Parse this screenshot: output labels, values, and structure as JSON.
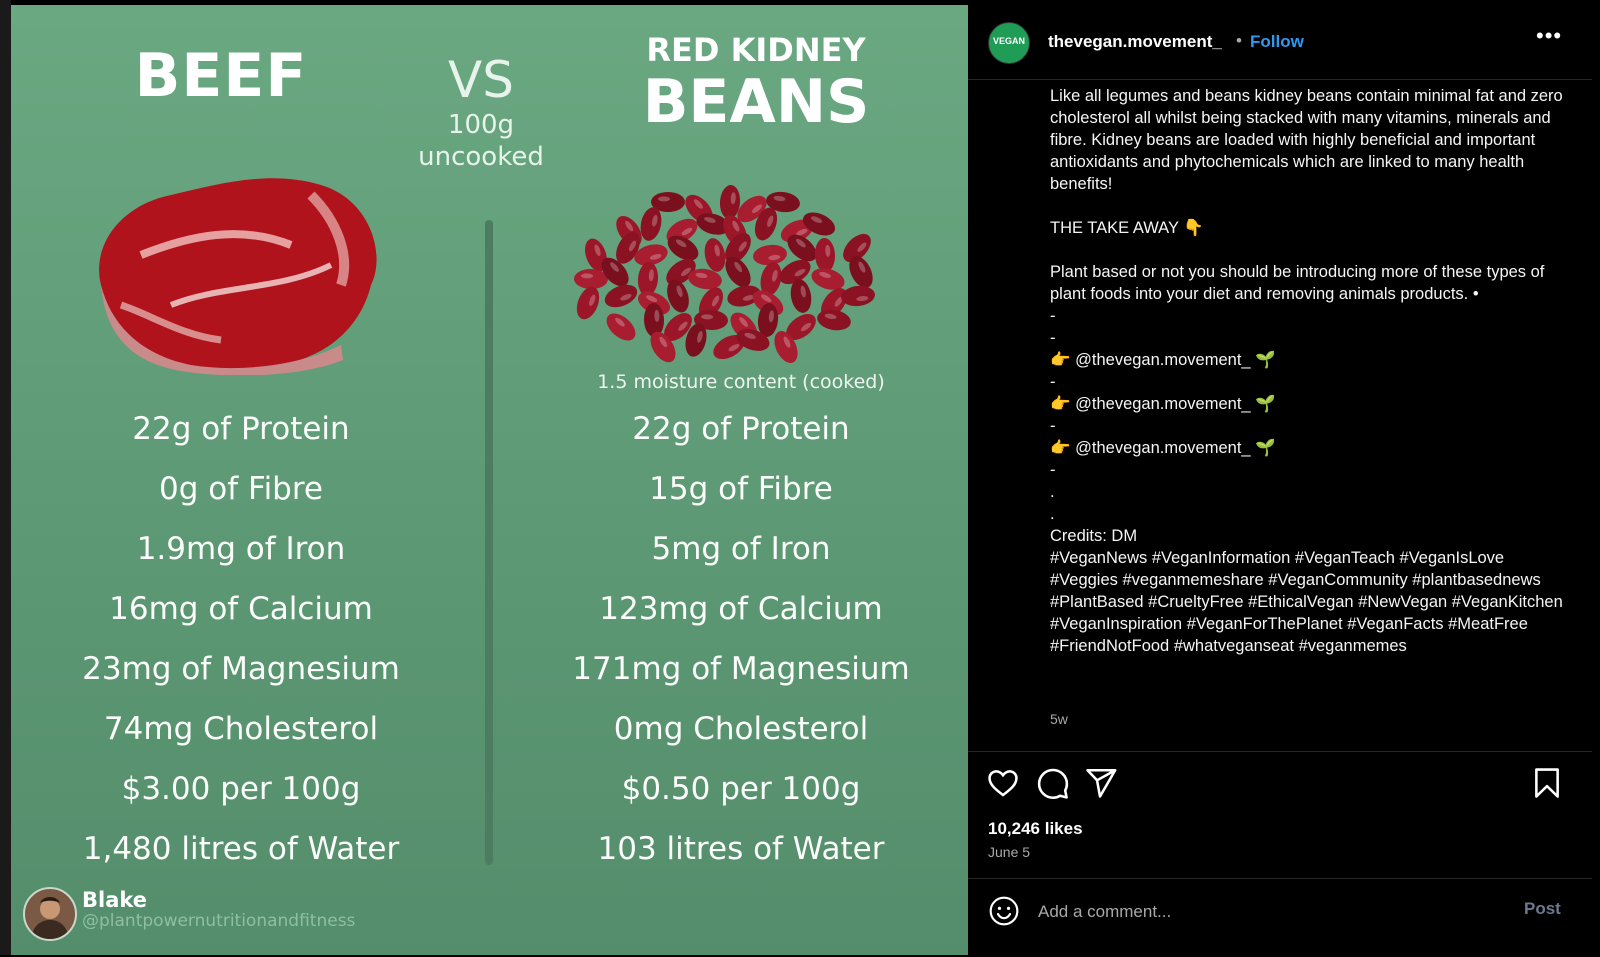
{
  "image": {
    "beef_title": "BEEF",
    "vs": "VS",
    "vs_sub_1": "100g",
    "vs_sub_2": "uncooked",
    "beans_title_1": "RED KIDNEY",
    "beans_title_2": "BEANS",
    "moisture_note": "1.5 moisture content (cooked)",
    "beef_stats": [
      "22g of Protein",
      "0g of Fibre",
      "1.9mg of Iron",
      "16mg of Calcium",
      "23mg of Magnesium",
      "74mg Cholesterol",
      "$3.00 per 100g",
      "1,480 litres of Water"
    ],
    "beans_stats": [
      "22g of Protein",
      "15g of Fibre",
      "5mg of Iron",
      "123mg of Calcium",
      "171mg of Magnesium",
      "0mg Cholesterol",
      "$0.50 per 100g",
      "103 litres of Water"
    ],
    "author_name": "Blake",
    "author_handle": "@plantpowernutritionandfitness"
  },
  "header": {
    "avatar_text": "VEGAN",
    "account": "thevegan.movement_",
    "separator": "•",
    "follow": "Follow",
    "more": "•••"
  },
  "caption": {
    "intro": "Like all legumes and beans kidney beans contain minimal fat and zero cholesterol all whilst being stacked with many vitamins, minerals and fibre. Kidney beans are loaded with highly beneficial and important antioxidants and phytochemicals which are linked to many health benefits!",
    "takeaway": "THE TAKE AWAY",
    "takeaway_emoji": "👇",
    "body": "Plant based or not you should be introducing more of these types of plant foods into your diet and removing animals products. •",
    "dash": "-",
    "dot": ".",
    "hand_emoji": "👉",
    "mention": "@thevegan.movement_",
    "sprout_emoji": "🌱",
    "credits": "Credits: DM",
    "hashtags": "#VeganNews #VeganInformation #VeganTeach #VeganIsLove #Veggies #veganmemeshare #VeganCommunity #plantbasednews #PlantBased #CrueltyFree #EthicalVegan #NewVegan #VeganKitchen #VeganInspiration #VeganForThePlanet #VeganFacts #MeatFree #FriendNotFood #whatveganseat #veganmemes",
    "time": "5w"
  },
  "footer": {
    "likes": "10,246 likes",
    "date": "June 5",
    "comment_placeholder": "Add a comment...",
    "post": "Post"
  },
  "colors": {
    "image_green": "#5e9a76",
    "follow_blue": "#2b9af3",
    "background": "#000000"
  },
  "icons": [
    "heart-icon",
    "comment-icon",
    "share-icon",
    "bookmark-icon",
    "emoji-icon"
  ]
}
